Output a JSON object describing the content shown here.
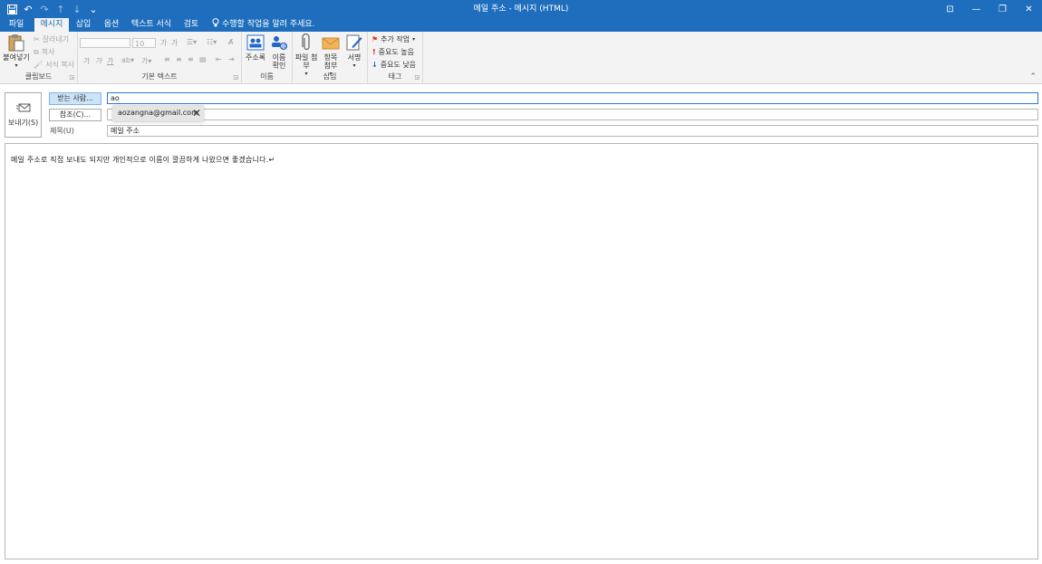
{
  "window": {
    "title": "메일 주소 - 메시지 (HTML)",
    "controls": {
      "ribbon_display": "⊡",
      "minimize": "—",
      "restore": "❐",
      "close": "✕"
    }
  },
  "qat": {
    "save": "💾",
    "undo": "↶",
    "redo": "↷",
    "up": "↑",
    "down": "↓",
    "customize": "⌄"
  },
  "tabs": [
    {
      "label": "파일",
      "active": false
    },
    {
      "label": "메시지",
      "active": true
    },
    {
      "label": "삽입",
      "active": false
    },
    {
      "label": "옵션",
      "active": false
    },
    {
      "label": "텍스트 서식",
      "active": false
    },
    {
      "label": "검토",
      "active": false
    }
  ],
  "tell_me": "수행할 작업을 알려 주세요.",
  "ribbon": {
    "clipboard": {
      "label": "클립보드",
      "paste": "붙여넣기",
      "cut": "잘라내기",
      "copy": "복사",
      "format_painter": "서식 복사"
    },
    "basic_text": {
      "label": "기본 텍스트",
      "font_size": "10",
      "grow": "가",
      "shrink": "가",
      "bold": "가",
      "italic": "가",
      "underline": "가",
      "highlight": "ab",
      "font_color": "가"
    },
    "names": {
      "label": "이름",
      "address_book": "주소록",
      "check_names": "이름 확인"
    },
    "include": {
      "label": "삽입",
      "attach_file": "파일 첨부",
      "attach_item": "항목 첨부",
      "signature": "서명"
    },
    "tags": {
      "label": "태그",
      "follow_up": "추가 작업",
      "high_importance": "중요도 높음",
      "low_importance": "중요도 낮음"
    },
    "colors": {
      "accent": "#1e6ebd",
      "flag": "#e23d2b",
      "high": "#d8251b",
      "low": "#2468c4"
    }
  },
  "compose": {
    "send": "보내기(S)",
    "to_button": "받는 사람...",
    "cc_button": "참조(C)...",
    "subject_label": "제목(U)",
    "to_value": "ao",
    "cc_value": "",
    "subject_value": "메일 주소",
    "suggestion": "aozangna@gmail.com",
    "body_text": "메일 주소로 직접 보내도 되지만 개인적으로 이름이 깔끔하게 나왔으면 좋겠습니다.↵"
  }
}
